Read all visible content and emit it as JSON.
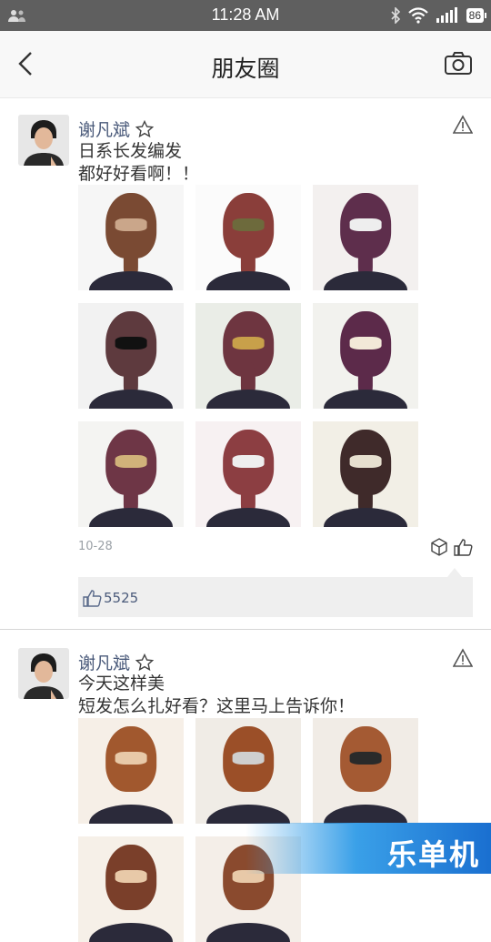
{
  "status_bar": {
    "time": "11:28 AM",
    "battery": "86"
  },
  "app_bar": {
    "title": "朋友圈"
  },
  "posts": [
    {
      "author": "谢凡斌",
      "text": "日系长发编发\n都好好看啊！！",
      "date": "10-28",
      "likes": "5525",
      "images": [
        {
          "hair": "#7a4a33",
          "bg": "#f6f6f6",
          "acc": "#caa68a"
        },
        {
          "hair": "#8a3e3a",
          "bg": "#fbfbfb",
          "acc": "#6d6a3c"
        },
        {
          "hair": "#5e2e4c",
          "bg": "#f3f0ef",
          "acc": "#eee"
        },
        {
          "hair": "#5e3a3e",
          "bg": "#f2f2f2",
          "acc": "#111"
        },
        {
          "hair": "#6e3540",
          "bg": "#eaede7",
          "acc": "#c8a04a"
        },
        {
          "hair": "#5c2a4a",
          "bg": "#f2f2ee",
          "acc": "#f2e9d8"
        },
        {
          "hair": "#6e3646",
          "bg": "#f4f4f2",
          "acc": "#d1b27a"
        },
        {
          "hair": "#8c3e42",
          "bg": "#f7f1f2",
          "acc": "#eee"
        },
        {
          "hair": "#3f2a2a",
          "bg": "#f2efe6",
          "acc": "#e6dfcf"
        }
      ]
    },
    {
      "author": "谢凡斌",
      "text": "今天这样美\n短发怎么扎好看？这里马上告诉你！",
      "images": [
        {
          "hair": "#a1582e",
          "bg": "#f6efe7",
          "acc": "#e8c9a8"
        },
        {
          "hair": "#9b4f28",
          "bg": "#f0ece6",
          "acc": "#cfcfcf"
        },
        {
          "hair": "#a45a33",
          "bg": "#f1ece6",
          "acc": "#2a2a2a"
        },
        {
          "hair": "#7a3f2a",
          "bg": "#f6f0e8",
          "acc": "#e8c9a8"
        },
        {
          "hair": "#8a4a2e",
          "bg": "#f4eee8",
          "acc": "#e8c9a8"
        }
      ]
    }
  ],
  "watermark": {
    "text": "乐单机"
  }
}
